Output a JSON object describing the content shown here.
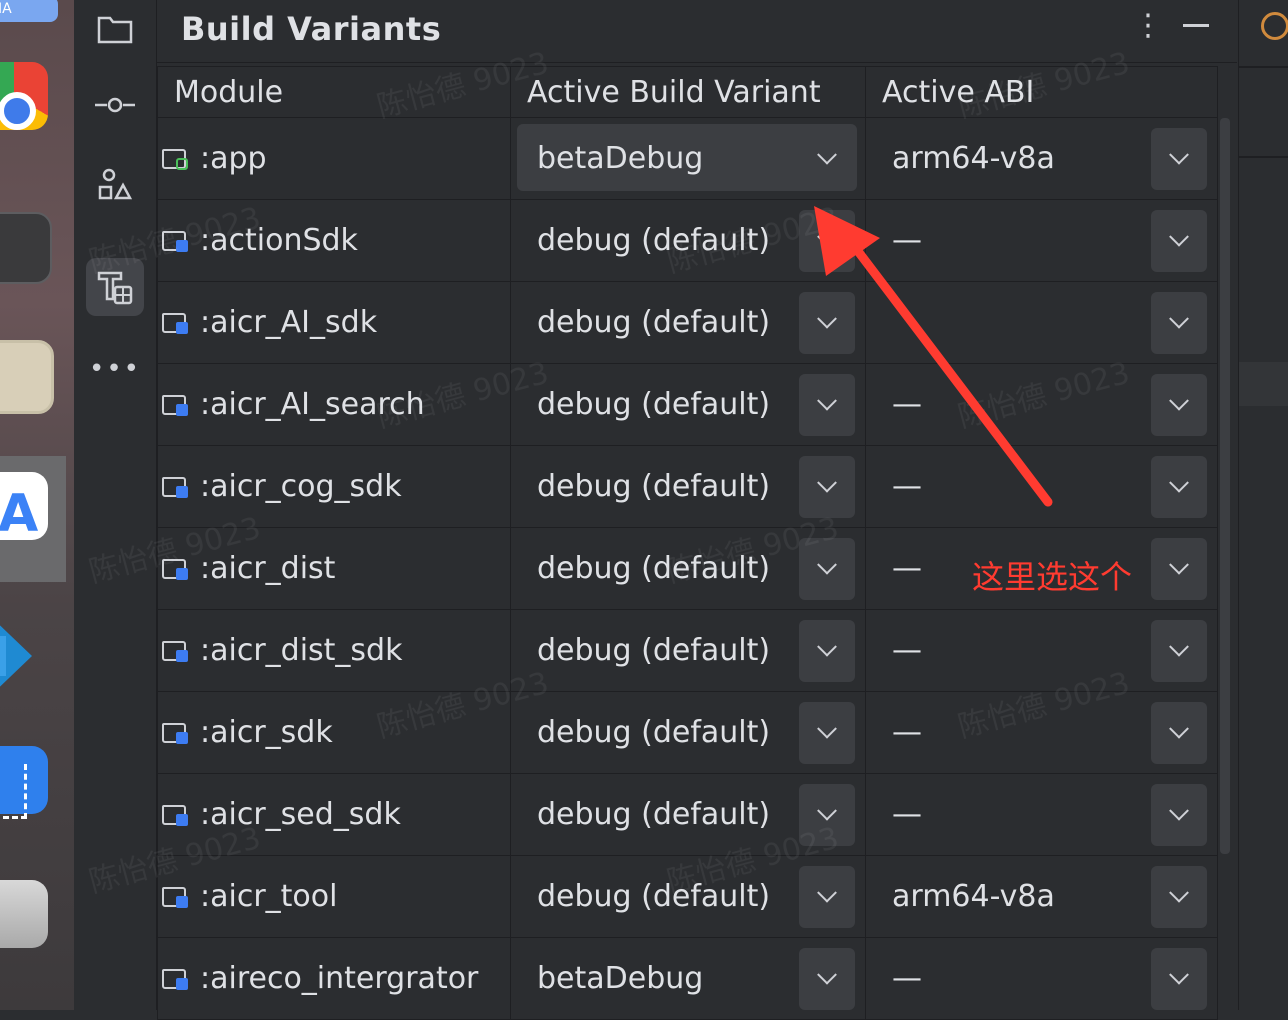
{
  "panel": {
    "title": "Build Variants",
    "kebab": "⋮"
  },
  "columns": {
    "module": "Module",
    "variant": "Active Build Variant",
    "abi": "Active ABI"
  },
  "rows": [
    {
      "module": ":app",
      "variant": "betaDebug",
      "abi": "arm64-v8a",
      "icon": "app-module-icon"
    },
    {
      "module": ":actionSdk",
      "variant": "debug (default)",
      "abi": "—",
      "icon": "library-module-icon"
    },
    {
      "module": ":aicr_AI_sdk",
      "variant": "debug (default)",
      "abi": "",
      "icon": "library-module-icon"
    },
    {
      "module": ":aicr_AI_search",
      "variant": "debug (default)",
      "abi": "—",
      "icon": "library-module-icon"
    },
    {
      "module": ":aicr_cog_sdk",
      "variant": "debug (default)",
      "abi": "—",
      "icon": "library-module-icon"
    },
    {
      "module": ":aicr_dist",
      "variant": "debug (default)",
      "abi": "—",
      "icon": "library-module-icon"
    },
    {
      "module": ":aicr_dist_sdk",
      "variant": "debug (default)",
      "abi": "—",
      "icon": "library-module-icon"
    },
    {
      "module": ":aicr_sdk",
      "variant": "debug (default)",
      "abi": "—",
      "icon": "library-module-icon"
    },
    {
      "module": ":aicr_sed_sdk",
      "variant": "debug (default)",
      "abi": "—",
      "icon": "library-module-icon"
    },
    {
      "module": ":aicr_tool",
      "variant": "debug (default)",
      "abi": "arm64-v8a",
      "icon": "library-module-icon"
    },
    {
      "module": ":aireco_intergrator",
      "variant": "betaDebug",
      "abi": "—",
      "icon": "library-module-icon"
    }
  ],
  "annotation": {
    "text": "这里选这个",
    "color": "#ff3b30"
  },
  "watermark": "陈怡德 9023",
  "dock": {
    "badge": "IA"
  },
  "colors": {
    "background": "#2b2d30",
    "dropdown": "#3c3e42",
    "text": "#dfe1e5"
  }
}
